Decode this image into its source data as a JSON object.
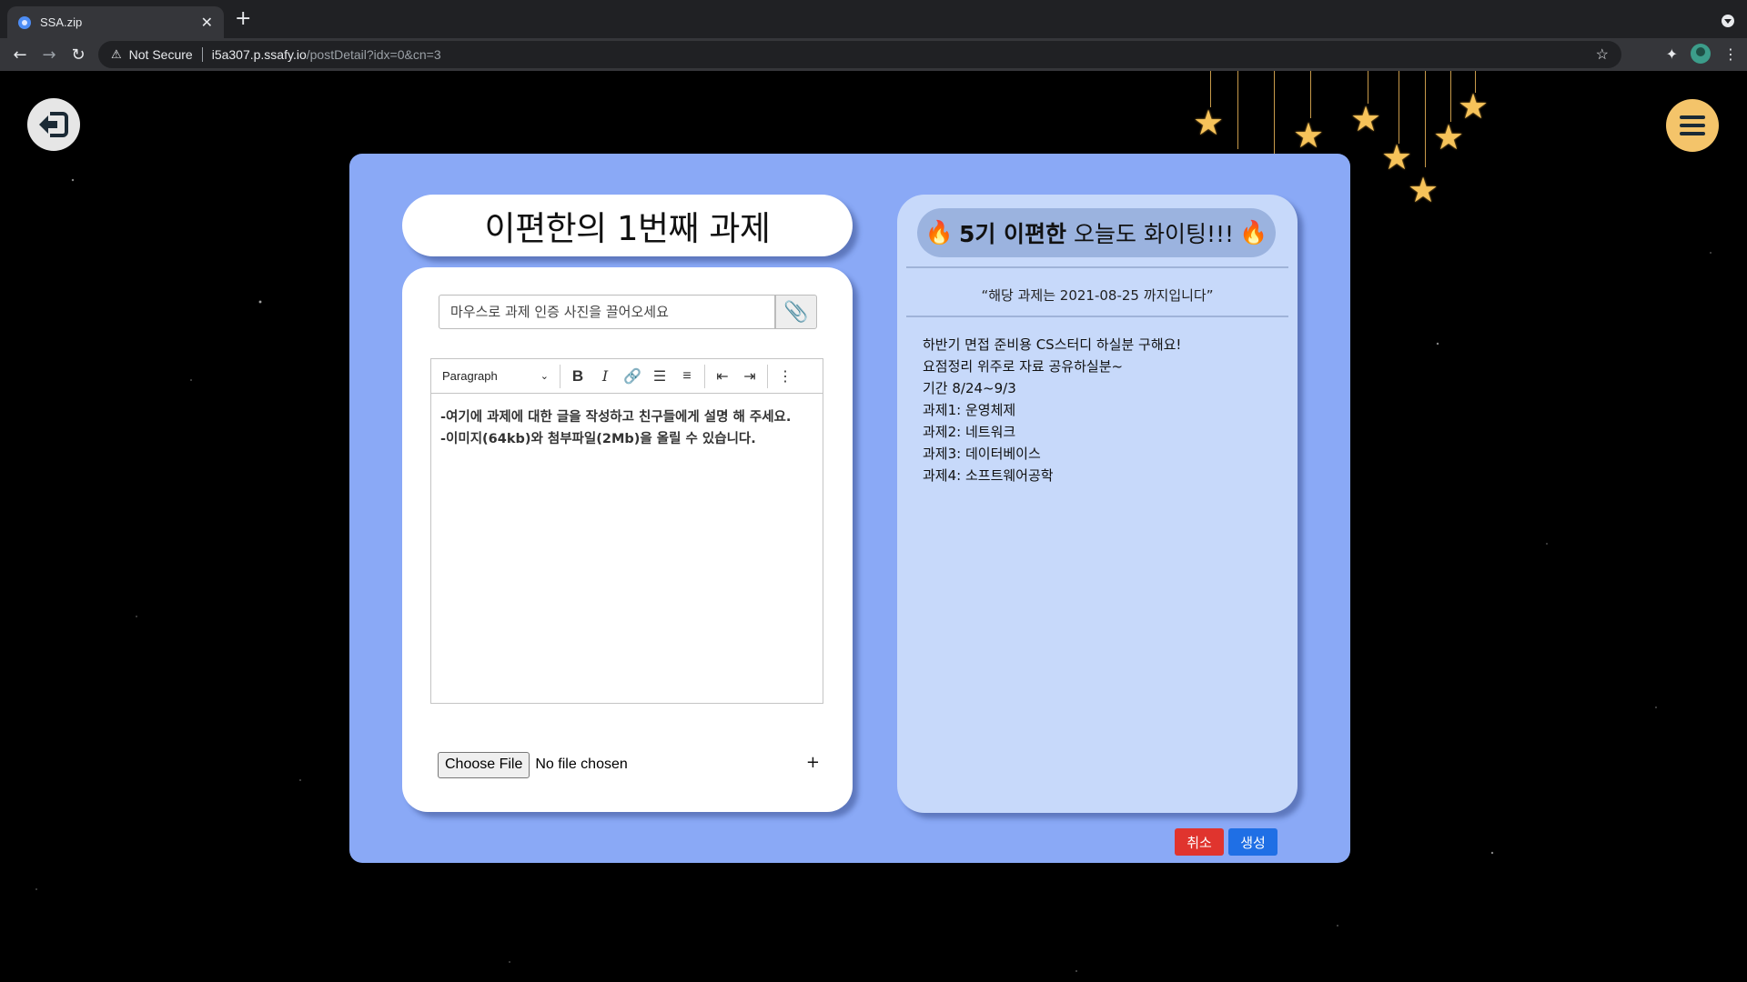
{
  "browser": {
    "tab_title": "SSA.zip",
    "security_label": "Not Secure",
    "url_host": "i5a307.p.ssafy.io",
    "url_path": "/postDetail?idx=0&cn=3"
  },
  "page": {
    "title": "이편한의 1번째 과제",
    "photo_placeholder": "마우스로 과제 인증 사진을 끌어오세요",
    "editor": {
      "paragraph_label": "Paragraph",
      "body_lines": [
        "-여기에 과제에 대한 글을 작성하고 친구들에게 설명 해 주세요.",
        "-이미지(64kb)와 첨부파일(2Mb)을 올릴 수 있습니다."
      ]
    },
    "file": {
      "choose_label": "Choose File",
      "status": "No file chosen",
      "add_label": "+"
    },
    "info": {
      "cheer_emoji": "🔥",
      "cheer_name": "5기 이편한",
      "cheer_text": "오늘도 화이팅!!!",
      "deadline": "“해당 과제는 2021-08-25 까지입니다”",
      "description": [
        "하반기 면접 준비용 CS스터디 하실분 구해요!",
        "요점정리 위주로 자료 공유하실분~",
        "기간 8/24~9/3",
        "과제1: 운영체제",
        "과제2: 네트워크",
        "과제3: 데이터베이스",
        "과제4: 소프트웨어공학"
      ]
    },
    "buttons": {
      "cancel": "취소",
      "create": "생성"
    }
  },
  "colors": {
    "board": "#8aa9f6",
    "info_card": "#c7d9fa",
    "cancel": "#e0342e",
    "create": "#1f6fe5",
    "menu_button": "#f4c46a",
    "star": "#f6c35a"
  }
}
